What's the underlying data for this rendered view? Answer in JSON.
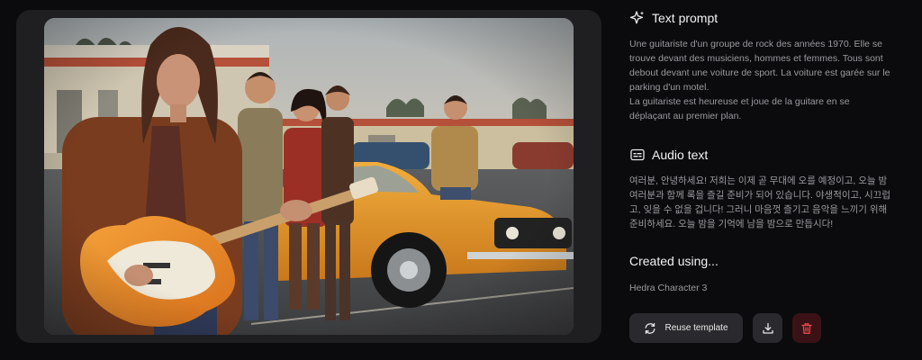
{
  "preview": {
    "image_label": "Generated video preview: female rock guitarist in a brown jacket holding an orange electric guitar, bandmates standing by a yellow-orange 1970s car in a motel parking lot"
  },
  "prompt_section": {
    "title": "Text prompt",
    "icon": "sparkle-icon",
    "lines": [
      "Une guitariste d'un groupe de rock des années 1970. Elle se",
      "trouve devant des musiciens, hommes et femmes. Tous sont",
      "debout devant une voiture de sport. La voiture est garée sur le",
      "parking d'un motel.",
      "La guitariste est heureuse et joue de la guitare en se",
      "déplaçant au premier plan."
    ]
  },
  "audio_section": {
    "title": "Audio text",
    "icon": "subtitles-icon",
    "lines": [
      "여러분, 안녕하세요! 저희는 이제 곧 무대에 오를 예정이고, 오늘 밤",
      "여러분과 함께 록을 즐길 준비가 되어 있습니다. 야생적이고, 시끄럽",
      "고, 잊을 수 없을 겁니다! 그러니 마음껏 즐기고 음악을 느끼기 위해",
      "준비하세요. 오늘 밤을 기억에 남을 밤으로 만듭시다!"
    ]
  },
  "created": {
    "title": "Created using...",
    "model": "Hedra Character 3"
  },
  "actions": {
    "reuse_label": "Reuse template",
    "reuse_icon": "reuse-icon",
    "download_icon": "download-icon",
    "delete_icon": "trash-icon"
  },
  "colors": {
    "background": "#0b0b0d",
    "card": "#1f1f22",
    "button": "#2a2a2e",
    "delete_button": "#3a1216",
    "delete_icon": "#e5484d",
    "muted_text": "#9a9aa0"
  }
}
